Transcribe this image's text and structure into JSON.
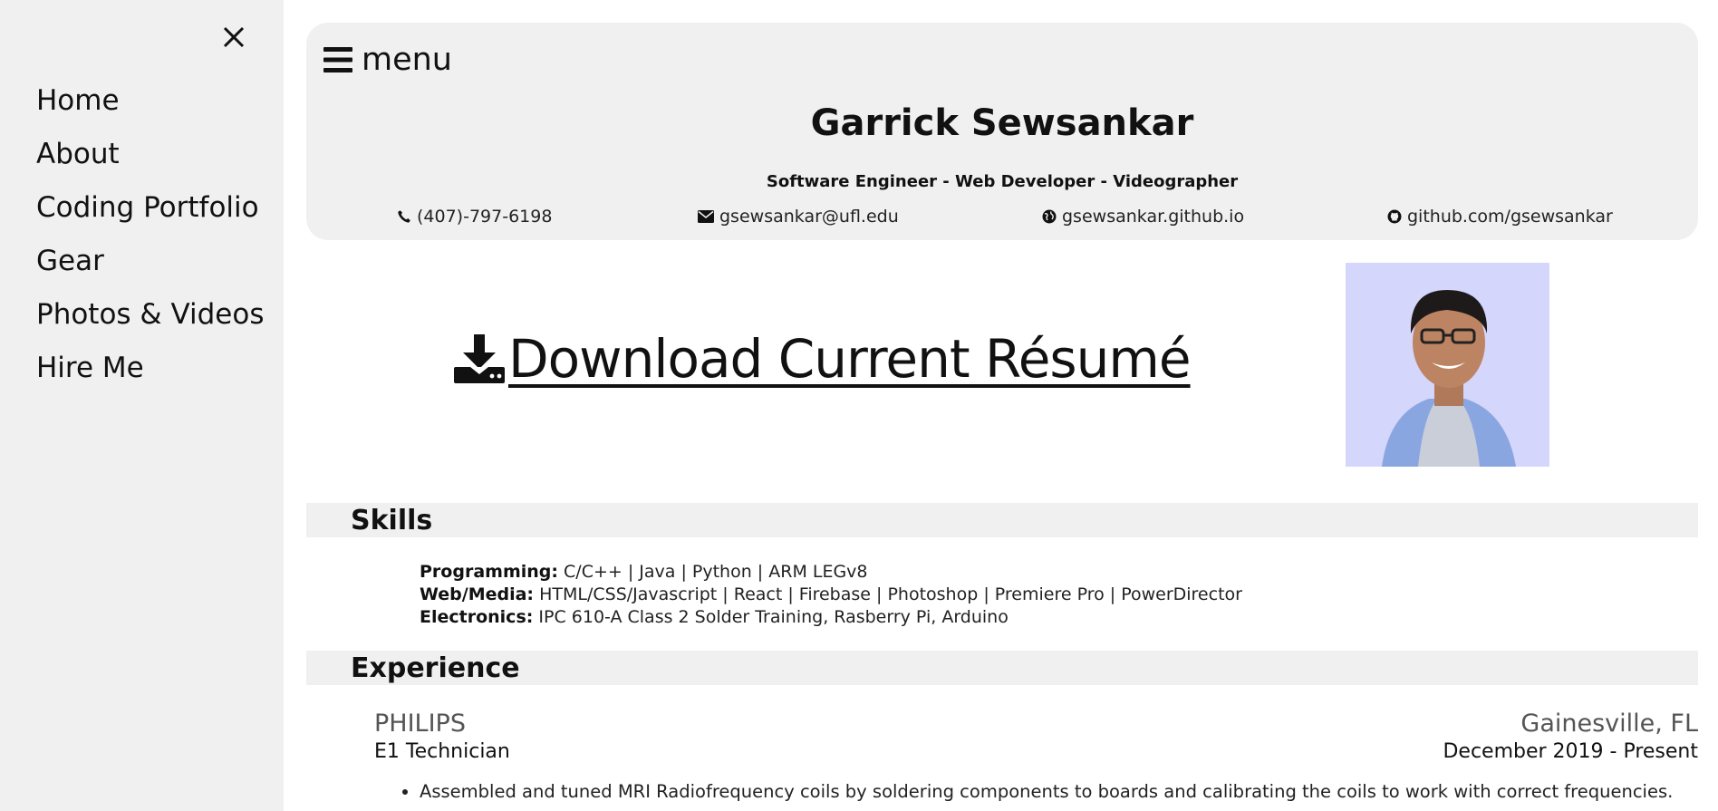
{
  "sidebar": {
    "close_icon": "close-icon",
    "items": [
      {
        "label": "Home"
      },
      {
        "label": "About"
      },
      {
        "label": "Coding Portfolio"
      },
      {
        "label": "Gear"
      },
      {
        "label": "Photos & Videos"
      },
      {
        "label": "Hire Me"
      }
    ]
  },
  "header": {
    "menu_label": "menu",
    "name": "Garrick Sewsankar",
    "tagline": "Software Engineer - Web Developer - Videographer",
    "contacts": {
      "phone": "(407)-797-6198",
      "email": "gsewsankar@ufl.edu",
      "website": "gsewsankar.github.io",
      "github": "github.com/gsewsankar"
    }
  },
  "download": {
    "label": "Download Current Résumé",
    "icon": "download-icon"
  },
  "skills": {
    "title": "Skills",
    "rows": [
      {
        "label": "Programming:",
        "value": "C/C++ | Java | Python | ARM LEGv8"
      },
      {
        "label": "Web/Media:",
        "value": "HTML/CSS/Javascript | React | Firebase | Photoshop | Premiere Pro | PowerDirector"
      },
      {
        "label": "Electronics:",
        "value": "IPC 610-A Class 2 Solder Training, Rasberry Pi, Arduino"
      }
    ]
  },
  "experience": {
    "title": "Experience",
    "jobs": [
      {
        "company": "PHILIPS",
        "location": "Gainesville, FL",
        "title": "E1 Technician",
        "dates": "December 2019 - Present",
        "bullets": [
          "Assembled and tuned MRI Radiofrequency coils by soldering components to boards and calibrating the coils to work with correct frequencies."
        ]
      }
    ]
  },
  "colors": {
    "panel": "#f0f0f0",
    "avatar_bg": "#d4d6fb",
    "shirt": "#8aa6e0"
  }
}
